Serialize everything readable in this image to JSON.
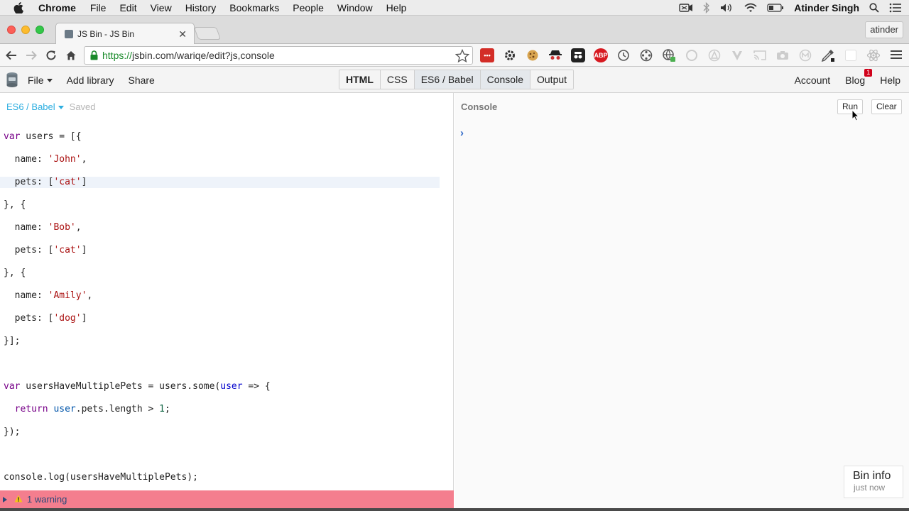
{
  "mac_menubar": {
    "app_name": "Chrome",
    "menus": [
      "File",
      "Edit",
      "View",
      "History",
      "Bookmarks",
      "People",
      "Window",
      "Help"
    ],
    "user_name": "Atinder Singh"
  },
  "browser": {
    "tab_title": "JS Bin - JS Bin",
    "profile_name": "atinder",
    "url_secure": "https://",
    "url_rest": "jsbin.com/wariqe/edit?js,console",
    "extensions": [
      "lastpass-icon",
      "gear-icon",
      "cookie-icon",
      "spy-icon",
      "incognito-icon",
      "adblock-icon",
      "refresh-ext-icon",
      "film-icon",
      "globe-icon",
      "circle-icon",
      "triangle-icon",
      "v-icon",
      "cast-icon",
      "camera-icon",
      "m-icon",
      "eyedropper-icon",
      "square-icon",
      "react-icon"
    ],
    "adblock_label": "ABP"
  },
  "jsbin": {
    "menu": {
      "file": "File",
      "add_library": "Add library",
      "share": "Share"
    },
    "panels": [
      "HTML",
      "CSS",
      "ES6 / Babel",
      "Console",
      "Output"
    ],
    "right": {
      "account": "Account",
      "blog": "Blog",
      "blog_badge": "1",
      "help": "Help"
    },
    "editor": {
      "language": "ES6 / Babel",
      "saved": "Saved",
      "warning_text": "1 warning"
    },
    "console": {
      "title": "Console",
      "run": "Run",
      "clear": "Clear",
      "prompt": "›"
    },
    "bin_info": {
      "title": "Bin info",
      "time": "just now"
    }
  },
  "colors": {
    "warning_bar": "#f47e8e",
    "accent": "#2daee0"
  }
}
